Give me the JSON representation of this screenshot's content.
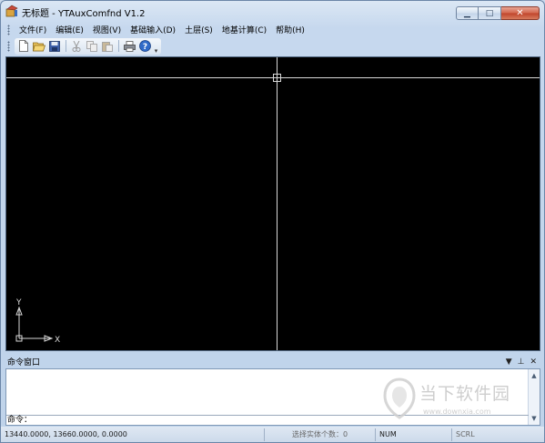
{
  "window": {
    "title": "无标题 - YTAuxComfnd V1.2",
    "buttons": {
      "min": "▁",
      "max": "□",
      "close": "✕"
    }
  },
  "menu": [
    {
      "label": "文件(F)"
    },
    {
      "label": "编辑(E)"
    },
    {
      "label": "视图(V)"
    },
    {
      "label": "基础输入(D)"
    },
    {
      "label": "土层(S)"
    },
    {
      "label": "地基计算(C)"
    },
    {
      "label": "帮助(H)"
    }
  ],
  "toolbar": {
    "buttons": [
      {
        "icon": "new-file-icon"
      },
      {
        "icon": "open-folder-icon"
      },
      {
        "icon": "save-icon"
      },
      {
        "icon": "cut-icon"
      },
      {
        "icon": "copy-icon"
      },
      {
        "icon": "paste-icon"
      },
      {
        "icon": "print-icon"
      },
      {
        "icon": "help-icon"
      }
    ]
  },
  "canvas": {
    "background": "#000000",
    "ucs": {
      "y_label": "Y",
      "x_label": "X"
    }
  },
  "command_window": {
    "title": "命令窗口",
    "controls": {
      "dropdown": "▼",
      "pin": "⊥",
      "close": "✕"
    },
    "prompt": "命令："
  },
  "watermark": {
    "text": "当下软件园",
    "url": "www.downxia.com"
  },
  "status_bar": {
    "coords": "13440.0000,  13660.0000,  0.0000",
    "selection": "选择实体个数：0",
    "num": "NUM",
    "scrl": "SCRL"
  },
  "colors": {
    "accent": "#c6d8ee",
    "close_button": "#c0432a"
  }
}
